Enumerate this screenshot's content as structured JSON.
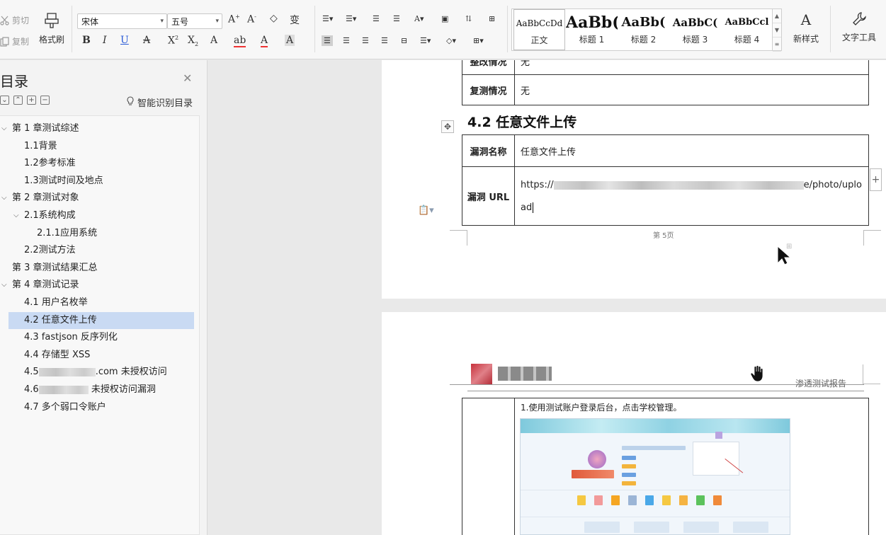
{
  "ribbon": {
    "cut_label": "剪切",
    "copy_label": "复制",
    "format_painter_label": "格式刷",
    "font_name": "宋体",
    "font_size": "五号",
    "styles": [
      {
        "sample": "AaBbCcDd",
        "name": "正文"
      },
      {
        "sample": "AaBb(",
        "name": "标题 1"
      },
      {
        "sample": "AaBb(",
        "name": "标题 2"
      },
      {
        "sample": "AaBbC(",
        "name": "标题 3"
      },
      {
        "sample": "AaBbCcl",
        "name": "标题 4"
      }
    ],
    "new_style_label": "新样式",
    "text_tools_label": "文字工具"
  },
  "toc": {
    "title": "目录",
    "smart_label": "智能识别目录",
    "items": [
      {
        "text": "第 1 章测试综述",
        "level": 0,
        "twisty": "v"
      },
      {
        "text": "1.1背景",
        "level": 1
      },
      {
        "text": "1.2参考标准",
        "level": 1
      },
      {
        "text": "1.3测试时间及地点",
        "level": 1
      },
      {
        "text": "第 2 章测试对象",
        "level": 0,
        "twisty": "v"
      },
      {
        "text": "2.1系统构成",
        "level": 1,
        "twisty": "v"
      },
      {
        "text": "2.1.1应用系统",
        "level": 2
      },
      {
        "text": "2.2测试方法",
        "level": 1
      },
      {
        "text": "第 3 章测试结果汇总",
        "level": 0
      },
      {
        "text": "第 4 章测试记录",
        "level": 0,
        "twisty": "v"
      },
      {
        "text": "4.1  用户名枚举",
        "level": 1
      },
      {
        "text": "4.2  任意文件上传",
        "level": 1,
        "active": true
      },
      {
        "text": "4.3 fastjson 反序列化",
        "level": 1
      },
      {
        "text": "4.4  存储型 XSS",
        "level": 1
      },
      {
        "text": "4.5",
        "suffix": ".com 未授权访问",
        "level": 1,
        "blur": 80
      },
      {
        "text": "4.6",
        "suffix": " 未授权访问漏洞",
        "level": 1,
        "blur": 70
      },
      {
        "text": "4.7  多个弱口令账户",
        "level": 1
      }
    ]
  },
  "doc": {
    "prev_rows": [
      {
        "label": "整改情况",
        "value": "无"
      },
      {
        "label": "复测情况",
        "value": "无"
      }
    ],
    "section_heading": "4.2  任意文件上传",
    "vuln_name_label": "漏洞名称",
    "vuln_name_value": "任意文件上传",
    "vuln_url_label": "漏洞 URL",
    "url_prefix": "https://",
    "url_suffix": "e/photo/uplo",
    "url_line2": "ad",
    "page_number": "第 5页",
    "header_right": "渗透测试报告",
    "step1": "1.使用测试账户登录后台，点击学校管理。"
  }
}
